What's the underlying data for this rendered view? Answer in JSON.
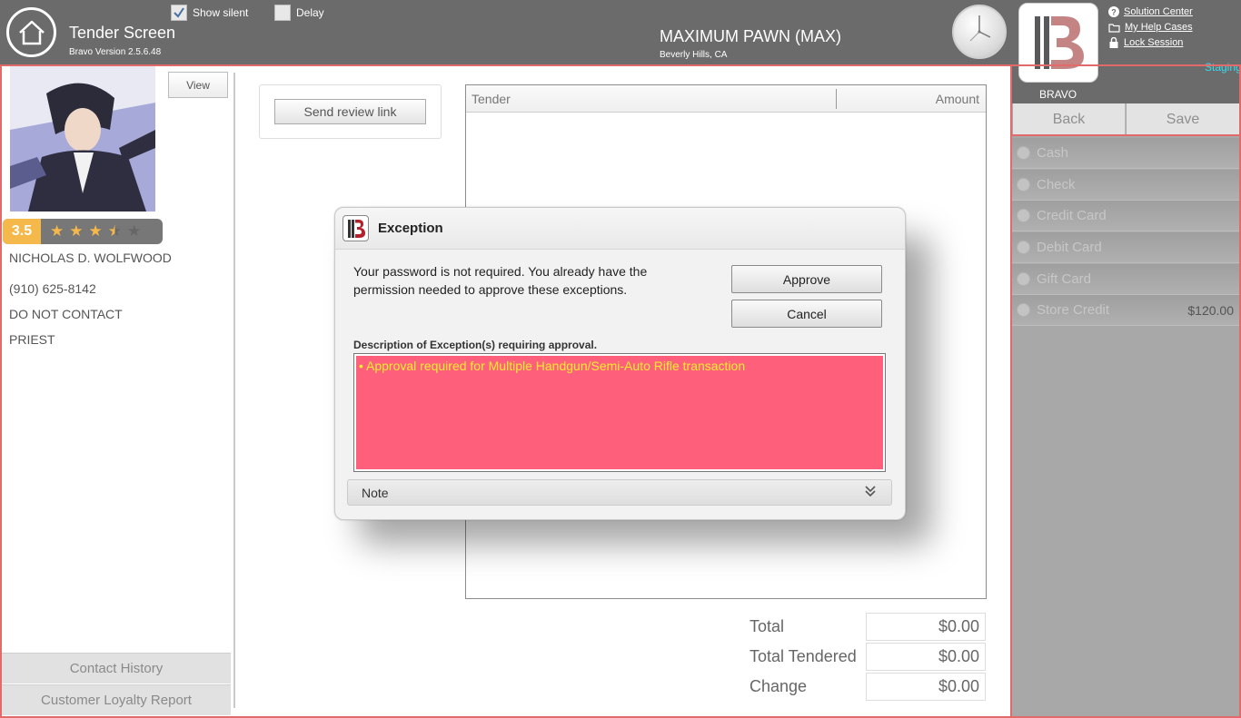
{
  "header": {
    "title": "Tender Screen",
    "version": "Bravo Version 2.5.6.48",
    "show_silent_label": "Show silent",
    "show_silent_checked": true,
    "delay_label": "Delay",
    "delay_checked": false,
    "store_name": "MAXIMUM PAWN (MAX)",
    "store_location": "Beverly Hills, CA",
    "bravo_label": "BRAVO",
    "links": {
      "solution_center": "Solution Center",
      "help_cases": "My Help Cases",
      "lock_session": "Lock Session"
    },
    "environment": "Staging",
    "environment_color": "#33ddee"
  },
  "customer": {
    "view_label": "View",
    "rating": "3.5",
    "rating_value": 3.5,
    "rating_max": 5,
    "name": "NICHOLAS D. WOLFWOOD",
    "phone": "(910) 625-8142",
    "contact_flag": "DO NOT CONTACT",
    "occupation": "PRIEST",
    "contact_history_label": "Contact History",
    "loyalty_report_label": "Customer Loyalty Report"
  },
  "main": {
    "send_review_label": "Send review link",
    "table_headers": {
      "tender": "Tender",
      "amount": "Amount"
    },
    "totals": [
      {
        "label": "Total",
        "value": "$0.00"
      },
      {
        "label": "Total Tendered",
        "value": "$0.00"
      },
      {
        "label": "Change",
        "value": "$0.00"
      }
    ]
  },
  "right": {
    "back_label": "Back",
    "save_label": "Save",
    "tender_options": [
      {
        "label": "Cash",
        "amount": ""
      },
      {
        "label": "Check",
        "amount": ""
      },
      {
        "label": "Credit Card",
        "amount": ""
      },
      {
        "label": "Debit Card",
        "amount": ""
      },
      {
        "label": "Gift Card",
        "amount": ""
      },
      {
        "label": "Store Credit",
        "amount": "$120.00"
      }
    ]
  },
  "modal": {
    "title": "Exception",
    "message": "Your password is not required. You already have the permission needed to approve these exceptions.",
    "approve_label": "Approve",
    "cancel_label": "Cancel",
    "description_label": "Description of Exception(s) requiring approval.",
    "exceptions": [
      "• Approval required for Multiple Handgun/Semi-Auto Rifle transaction"
    ],
    "note_label": "Note",
    "highlight_color": "#fe607c"
  },
  "colors": {
    "header_bg": "#6b6b6b",
    "frame_red": "#e16b6b",
    "rating_badge": "#f5b84a",
    "star_color": "#f5b84a"
  }
}
